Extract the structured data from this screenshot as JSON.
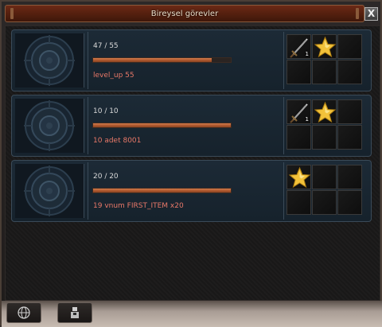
{
  "window": {
    "title": "Bireysel görevler",
    "close_label": "X"
  },
  "quests": [
    {
      "progress_text": "47 / 55",
      "progress_fraction": 0.855,
      "objective": "level_up 55",
      "icon": "seal-emblem-icon",
      "rewards": [
        {
          "icon": "sword-icon",
          "count": "1"
        },
        {
          "icon": "star-icon",
          "count": ""
        }
      ]
    },
    {
      "progress_text": "10 / 10",
      "progress_fraction": 1.0,
      "objective": "10 adet 8001",
      "icon": "seal-emblem-icon",
      "rewards": [
        {
          "icon": "sword-icon",
          "count": "1"
        },
        {
          "icon": "star-icon",
          "count": ""
        }
      ]
    },
    {
      "progress_text": "20 / 20",
      "progress_fraction": 1.0,
      "objective": "19 vnum FIRST_ITEM x20",
      "icon": "seal-emblem-icon",
      "rewards": [
        {
          "icon": "star-icon",
          "count": ""
        }
      ]
    }
  ],
  "tabs": [
    {
      "icon": "globe-icon"
    },
    {
      "icon": "character-icon"
    }
  ],
  "colors": {
    "title_bar": "#55200f",
    "progress_fill": "#c06a3a",
    "objective_text": "#e87868"
  }
}
